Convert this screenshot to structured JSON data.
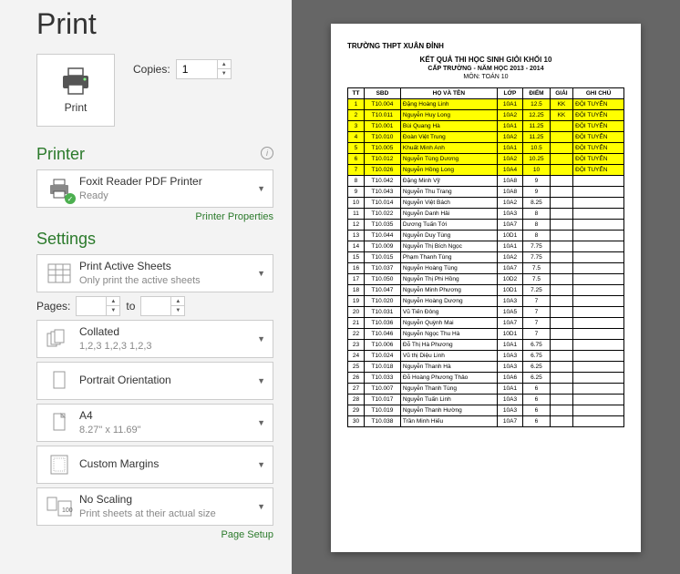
{
  "title": "Print",
  "print_button": "Print",
  "copies_label": "Copies:",
  "copies_value": "1",
  "printer_section": "Printer",
  "printer_name": "Foxit Reader PDF Printer",
  "printer_status": "Ready",
  "printer_props": "Printer Properties",
  "settings_section": "Settings",
  "print_active": {
    "t": "Print Active Sheets",
    "s": "Only print the active sheets"
  },
  "pages_label": "Pages:",
  "pages_to": "to",
  "collated": {
    "t": "Collated",
    "s": "1,2,3    1,2,3    1,2,3"
  },
  "orientation": {
    "t": "Portrait Orientation",
    "s": ""
  },
  "paper": {
    "t": "A4",
    "s": "8.27\" x 11.69\""
  },
  "margins": {
    "t": "Custom Margins",
    "s": ""
  },
  "scaling": {
    "t": "No Scaling",
    "s": "Print sheets at their actual size"
  },
  "page_setup": "Page Setup",
  "doc": {
    "school": "TRƯỜNG THPT XUÂN ĐỈNH",
    "h2": "KẾT QUẢ THI HỌC SINH GIỎI KHỐI 10",
    "h3": "CẤP TRƯỜNG - NĂM HỌC 2013 - 2014",
    "h4": "MÔN: TOÁN 10",
    "cols": [
      "TT",
      "SBD",
      "HỌ VÀ TÊN",
      "LỚP",
      "ĐIỂM",
      "GIẢI",
      "GHI CHÚ"
    ],
    "rows": [
      {
        "hl": true,
        "d": [
          "1",
          "T10.004",
          "Đặng Hoàng Linh",
          "10A1",
          "12.5",
          "KK",
          "ĐỘI TUYỂN"
        ]
      },
      {
        "hl": true,
        "d": [
          "2",
          "T10.011",
          "Nguyễn Huy Long",
          "10A2",
          "12.25",
          "KK",
          "ĐỘI TUYỂN"
        ]
      },
      {
        "hl": true,
        "d": [
          "3",
          "T10.001",
          "Bùi Quang Hà",
          "10A1",
          "11.25",
          "",
          "ĐỘI TUYỂN"
        ]
      },
      {
        "hl": true,
        "d": [
          "4",
          "T10.010",
          "Đoàn Việt Trung",
          "10A2",
          "11.25",
          "",
          "ĐỘI TUYỂN"
        ]
      },
      {
        "hl": true,
        "d": [
          "5",
          "T10.005",
          "Khuất Minh Anh",
          "10A1",
          "10.5",
          "",
          "ĐỘI TUYỂN"
        ]
      },
      {
        "hl": true,
        "d": [
          "6",
          "T10.012",
          "Nguyễn Tùng Dương",
          "10A2",
          "10.25",
          "",
          "ĐỘI TUYỂN"
        ]
      },
      {
        "hl": true,
        "d": [
          "7",
          "T10.026",
          "Nguyễn Hồng Long",
          "10A4",
          "10",
          "",
          "ĐỘI TUYỂN"
        ]
      },
      {
        "hl": false,
        "d": [
          "8",
          "T10.042",
          "Đặng Minh Vỹ",
          "10A8",
          "9",
          "",
          ""
        ]
      },
      {
        "hl": false,
        "d": [
          "9",
          "T10.043",
          "Nguyễn Thu Trang",
          "10A8",
          "9",
          "",
          ""
        ]
      },
      {
        "hl": false,
        "d": [
          "10",
          "T10.014",
          "Nguyễn Việt Bách",
          "10A2",
          "8.25",
          "",
          ""
        ]
      },
      {
        "hl": false,
        "d": [
          "11",
          "T10.022",
          "Nguyễn Danh Hải",
          "10A3",
          "8",
          "",
          ""
        ]
      },
      {
        "hl": false,
        "d": [
          "12",
          "T10.035",
          "Dương Tuấn Tới",
          "10A7",
          "8",
          "",
          ""
        ]
      },
      {
        "hl": false,
        "d": [
          "13",
          "T10.044",
          "Nguyễn Duy Tùng",
          "10D1",
          "8",
          "",
          ""
        ]
      },
      {
        "hl": false,
        "d": [
          "14",
          "T10.009",
          "Nguyễn Thị Bích Ngọc",
          "10A1",
          "7.75",
          "",
          ""
        ]
      },
      {
        "hl": false,
        "d": [
          "15",
          "T10.015",
          "Phạm Thanh Tùng",
          "10A2",
          "7.75",
          "",
          ""
        ]
      },
      {
        "hl": false,
        "d": [
          "16",
          "T10.037",
          "Nguyễn Hoàng Tùng",
          "10A7",
          "7.5",
          "",
          ""
        ]
      },
      {
        "hl": false,
        "d": [
          "17",
          "T10.050",
          "Nguyễn Thị Phi Hồng",
          "10D2",
          "7.5",
          "",
          ""
        ]
      },
      {
        "hl": false,
        "d": [
          "18",
          "T10.047",
          "Nguyễn Minh Phương",
          "10D1",
          "7.25",
          "",
          ""
        ]
      },
      {
        "hl": false,
        "d": [
          "19",
          "T10.020",
          "Nguyễn Hoàng Dương",
          "10A3",
          "7",
          "",
          ""
        ]
      },
      {
        "hl": false,
        "d": [
          "20",
          "T10.031",
          "Vũ Tiến Đông",
          "10A5",
          "7",
          "",
          ""
        ]
      },
      {
        "hl": false,
        "d": [
          "21",
          "T10.036",
          "Nguyễn Quỳnh Mai",
          "10A7",
          "7",
          "",
          ""
        ]
      },
      {
        "hl": false,
        "d": [
          "22",
          "T10.046",
          "Nguyễn Ngọc Thu Hà",
          "10D1",
          "7",
          "",
          ""
        ]
      },
      {
        "hl": false,
        "d": [
          "23",
          "T10.006",
          "Đỗ Thị Hà Phương",
          "10A1",
          "6.75",
          "",
          ""
        ]
      },
      {
        "hl": false,
        "d": [
          "24",
          "T10.024",
          "Vũ thị Diệu Linh",
          "10A3",
          "6.75",
          "",
          ""
        ]
      },
      {
        "hl": false,
        "d": [
          "25",
          "T10.018",
          "Nguyễn Thanh Hà",
          "10A3",
          "6.25",
          "",
          ""
        ]
      },
      {
        "hl": false,
        "d": [
          "26",
          "T10.033",
          "Đỗ Hoàng Phương Thảo",
          "10A6",
          "6.25",
          "",
          ""
        ]
      },
      {
        "hl": false,
        "d": [
          "27",
          "T10.007",
          "Nguyễn Thanh Tùng",
          "10A1",
          "6",
          "",
          ""
        ]
      },
      {
        "hl": false,
        "d": [
          "28",
          "T10.017",
          "Nguyễn Tuấn Linh",
          "10A3",
          "6",
          "",
          ""
        ]
      },
      {
        "hl": false,
        "d": [
          "29",
          "T10.019",
          "Nguyễn Thanh Hường",
          "10A3",
          "6",
          "",
          ""
        ]
      },
      {
        "hl": false,
        "d": [
          "30",
          "T10.038",
          "Trần Minh Hiếu",
          "10A7",
          "6",
          "",
          ""
        ]
      }
    ]
  }
}
